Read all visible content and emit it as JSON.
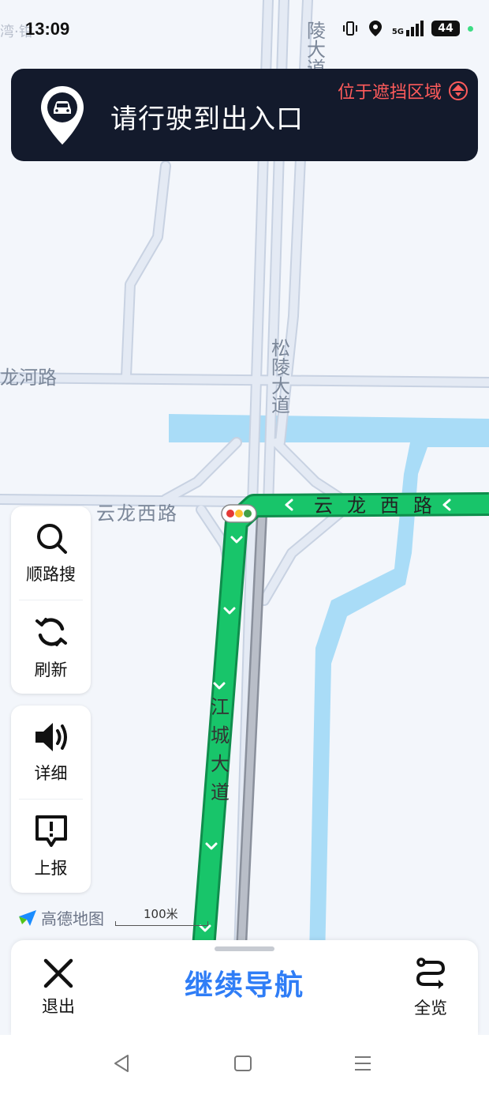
{
  "status_bar": {
    "time": "13:09",
    "left_faint_text": "湾·钳",
    "battery": "44",
    "network": "5G"
  },
  "banner": {
    "instruction": "请行驶到出入口",
    "alert": "位于遮挡区域",
    "icon": "car-location-pin-icon"
  },
  "map": {
    "road_labels": {
      "top_road_fragment": "陵大道辅",
      "songling": "松陵大道",
      "longhe": "龙河路",
      "yunlong_west_left": "云龙西路",
      "yunlong_west_route": "云龙西路",
      "jiangcheng": "江城大道"
    },
    "colors": {
      "route": "#18c56a",
      "route_border": "#0f8d4c",
      "water": "#a9dcf7",
      "road": "#dfe6f1",
      "road_edge": "#c8d2e2"
    }
  },
  "side_tools": {
    "search_along": "顺路搜",
    "refresh": "刷新",
    "detail": "详细",
    "report": "上报"
  },
  "brand": {
    "logo": "高德地图",
    "scale": "100米"
  },
  "bottom": {
    "exit": "退出",
    "continue": "继续导航",
    "overview": "全览"
  }
}
